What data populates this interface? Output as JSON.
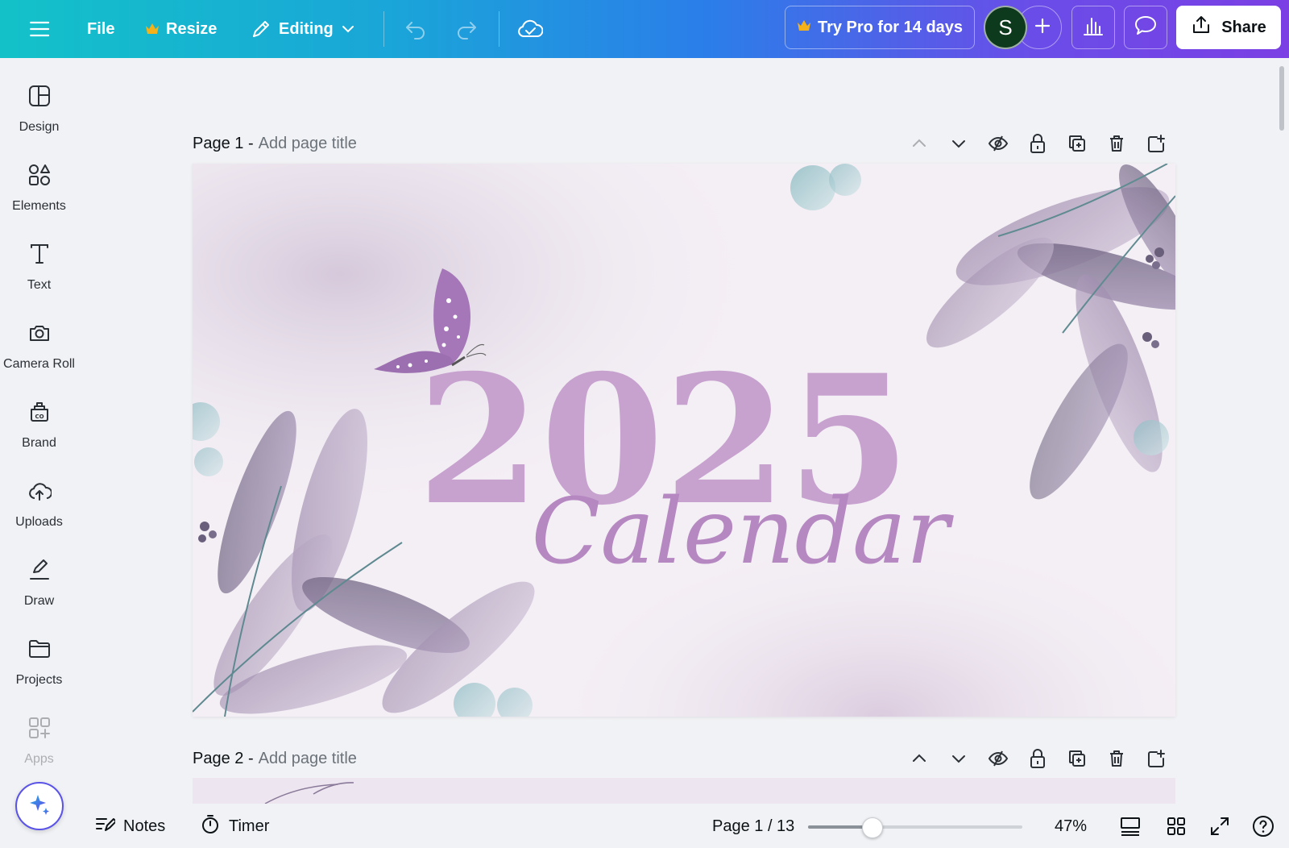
{
  "topbar": {
    "file_label": "File",
    "resize_label": "Resize",
    "editing_label": "Editing",
    "pro_label": "Try Pro for 14 days",
    "avatar_initial": "S",
    "share_label": "Share",
    "crown_color": "#f5b11a"
  },
  "sidebar": {
    "items": [
      {
        "label": "Design",
        "icon": "design-icon"
      },
      {
        "label": "Elements",
        "icon": "elements-icon"
      },
      {
        "label": "Text",
        "icon": "text-icon"
      },
      {
        "label": "Camera Roll",
        "icon": "camera-icon"
      },
      {
        "label": "Brand",
        "icon": "brand-icon"
      },
      {
        "label": "Uploads",
        "icon": "uploads-icon"
      },
      {
        "label": "Draw",
        "icon": "draw-icon"
      },
      {
        "label": "Projects",
        "icon": "projects-icon"
      },
      {
        "label": "Apps",
        "icon": "apps-icon"
      }
    ]
  },
  "pages": [
    {
      "number": "Page 1 -",
      "title_placeholder": "Add page title"
    },
    {
      "number": "Page 2 -",
      "title_placeholder": "Add page title"
    }
  ],
  "design": {
    "year": "2025",
    "script": "Calendar",
    "text_color": "#c7a2cf"
  },
  "bottombar": {
    "notes_label": "Notes",
    "timer_label": "Timer",
    "page_indicator": "Page 1 / 13",
    "zoom": "47%",
    "zoom_value": 47
  }
}
